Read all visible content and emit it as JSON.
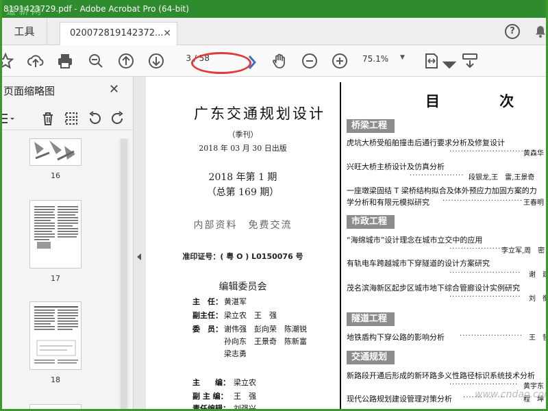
{
  "window": {
    "title": "8191423729.pdf - Adobe Acrobat Pro (64-bit)",
    "watermark_top": "道 新 网"
  },
  "tabs": {
    "tools_label": "工具",
    "doc_tab_label": "020072819142372..."
  },
  "toolbar": {
    "current_page": "3",
    "total_pages": "/ 58",
    "zoom": "75.1%"
  },
  "panel": {
    "title": "页面缩略图",
    "thumbs": [
      {
        "label": "16"
      },
      {
        "label": "17"
      },
      {
        "label": "18"
      }
    ]
  },
  "page_left": {
    "title": "广东交通规划设计",
    "quarterly": "（季刊）",
    "pub_date": "2018 年 03 月 30 日出版",
    "issue": "2018 年第 1 期",
    "total_issue": "（总第 169 期）",
    "internal": "内部资料　免费交流",
    "permit": "准印证号：( 粤 O ) L0150076 号",
    "committee_title": "编辑委员会",
    "committee": [
      {
        "role": "主　任：",
        "names": "黄湛军"
      },
      {
        "role": "副主任：",
        "names": "梁立农　王　强"
      },
      {
        "role": "委　员：",
        "names": "谢伟强　彭向荣　陈潮锐"
      },
      {
        "role": "",
        "names": "孙向东　王景奇　陈新富"
      },
      {
        "role": "",
        "names": "梁志勇"
      }
    ],
    "editors": [
      {
        "role": "主　　编：",
        "names": "梁立农"
      },
      {
        "role": "副 主 编：",
        "names": "王　强"
      },
      {
        "role": "责任编辑：",
        "names": "刘强兴"
      }
    ]
  },
  "page_right": {
    "toc_title": "目 次",
    "sections": [
      {
        "name": "桥梁工程",
        "articles": [
          {
            "title": "虎坑大桥受船舶撞击后通行要求分析及修复设计",
            "author": "黄森华"
          },
          {
            "title": "兴旺大桥主桥设计及仿真分析",
            "author": "段银龙,王　雷,王景奇"
          },
          {
            "title": "一座墩梁固结 T 梁桥结构拟合及体外预应力加固方案的力",
            "title2": "学分析和有限元模拟研究",
            "author": "王春明"
          }
        ]
      },
      {
        "name": "市政工程",
        "articles": [
          {
            "title": "“海绵城市”设计理念在城市立交中的应用",
            "author": "李立军,周　密"
          },
          {
            "title": "有轨电车跨越城市下穿隧道的设计方案研究",
            "author": "谢　建"
          },
          {
            "title": "茂名滨海新区起步区城市地下综合管廊设计实例研究",
            "author": "刘　衡"
          }
        ]
      },
      {
        "name": "隧道工程",
        "articles": [
          {
            "title": "地铁盾构下穿公路的影响分析",
            "author": "王　哲"
          }
        ]
      },
      {
        "name": "交通规划",
        "articles": [
          {
            "title": "新路段开通后形成的新环路多义性路径标识系统技术分析",
            "author": "黄宇东"
          },
          {
            "title": "现代公路规划建设管理对策分析",
            "author": "程　坤"
          }
        ]
      }
    ]
  },
  "footer_watermark": "www.cndao.com",
  "colors": {
    "titlebar": "#2e8b2e",
    "highlight_oval": "#e23a3a",
    "section_bg": "#8c8c8c"
  }
}
